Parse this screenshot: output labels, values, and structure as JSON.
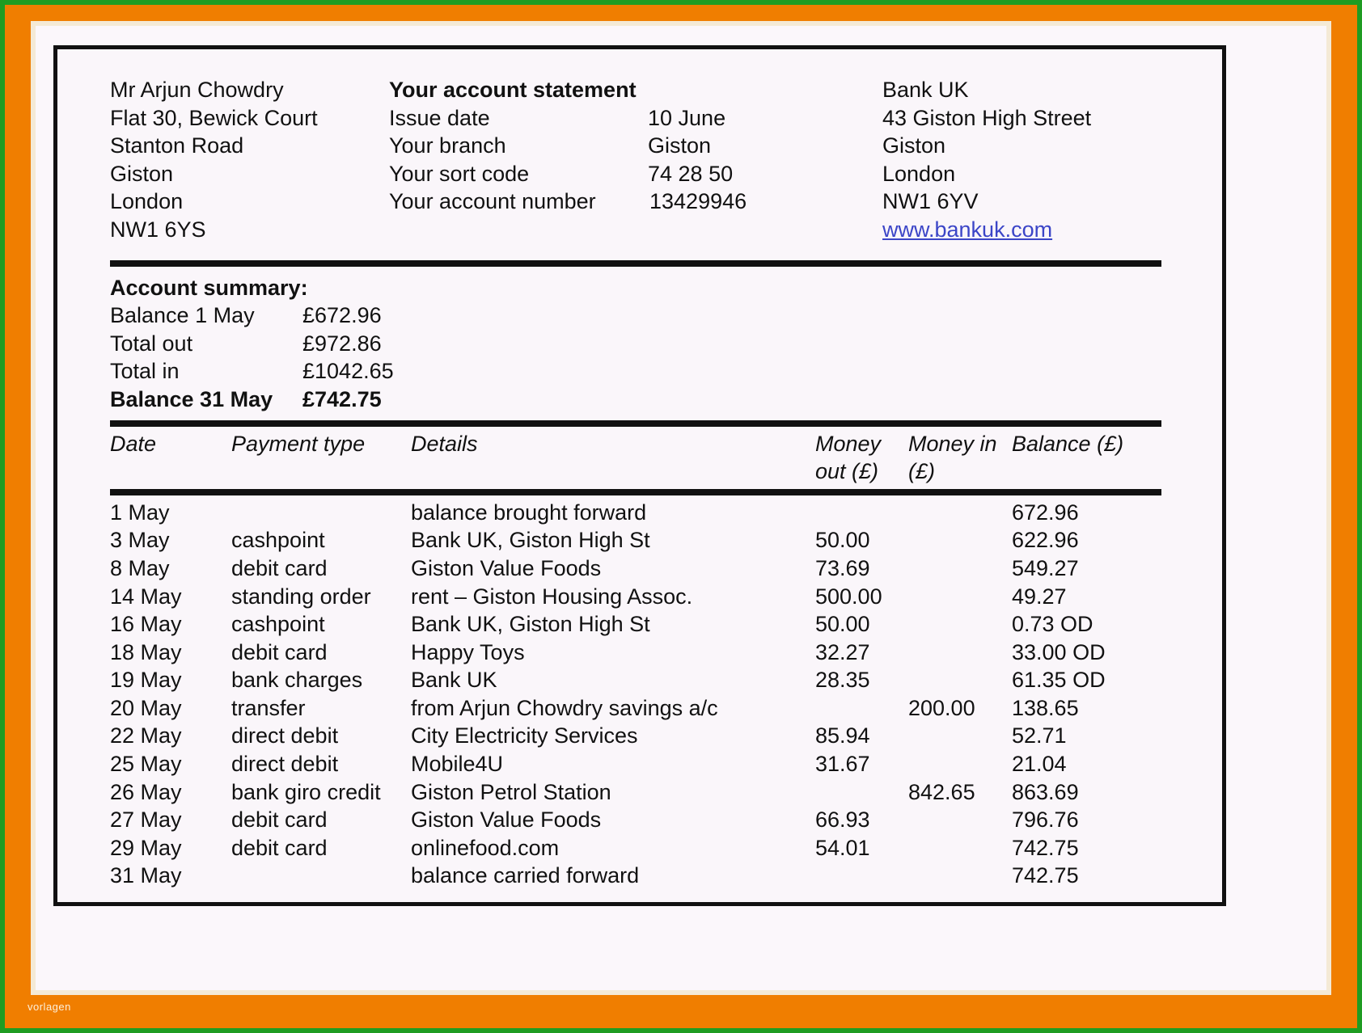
{
  "document": {
    "watermark": "vorlagen",
    "title": "Your account statement"
  },
  "customer": {
    "name": "Mr Arjun Chowdry",
    "address_lines": [
      "Flat 30, Bewick Court",
      "Stanton Road",
      "Giston",
      "London",
      "NW1 6YS"
    ]
  },
  "statement_info": {
    "heading": "Your account statement",
    "fields": [
      {
        "label": "Issue date",
        "value": "10 June"
      },
      {
        "label": "Your branch",
        "value": "Giston"
      },
      {
        "label": "Your sort code",
        "value": "74 28 50"
      },
      {
        "label": "Your account number",
        "value": "13429946"
      }
    ]
  },
  "bank": {
    "name": "Bank UK",
    "address_lines": [
      "43 Giston High Street",
      "Giston",
      "London",
      "NW1 6YV"
    ],
    "website": "www.bankuk.com"
  },
  "summary": {
    "title": "Account summary:",
    "rows": [
      {
        "label": "Balance 1 May",
        "value": "£672.96",
        "bold": false
      },
      {
        "label": "Total out",
        "value": "£972.86",
        "bold": false
      },
      {
        "label": "Total in",
        "value": "£1042.65",
        "bold": false
      },
      {
        "label": "Balance 31 May",
        "value": "£742.75",
        "bold": true
      }
    ]
  },
  "transactions": {
    "columns": {
      "date": "Date",
      "payment_type": "Payment type",
      "details": "Details",
      "money_out_1": "Money",
      "money_out_2": "out (£)",
      "money_in_1": "Money in",
      "money_in_2": "(£)",
      "balance": "Balance (£)"
    },
    "rows": [
      {
        "date": "1 May",
        "type": "",
        "details": "balance brought forward",
        "out": "",
        "in": "",
        "balance": "672.96",
        "bold": true
      },
      {
        "date": "3 May",
        "type": "cashpoint",
        "details": "Bank UK, Giston High St",
        "out": "50.00",
        "in": "",
        "balance": "622.96",
        "bold": false
      },
      {
        "date": "8 May",
        "type": "debit card",
        "details": "Giston Value Foods",
        "out": "73.69",
        "in": "",
        "balance": "549.27",
        "bold": false
      },
      {
        "date": "14 May",
        "type": "standing order",
        "details": "rent – Giston Housing Assoc.",
        "out": "500.00",
        "in": "",
        "balance": "49.27",
        "bold": false
      },
      {
        "date": "16 May",
        "type": "cashpoint",
        "details": "Bank UK, Giston High St",
        "out": "50.00",
        "in": "",
        "balance": "0.73 OD",
        "bold": false
      },
      {
        "date": "18 May",
        "type": "debit card",
        "details": "Happy Toys",
        "out": "32.27",
        "in": "",
        "balance": "33.00 OD",
        "bold": false
      },
      {
        "date": "19 May",
        "type": "bank charges",
        "details": "Bank UK",
        "out": "28.35",
        "in": "",
        "balance": "61.35 OD",
        "bold": false
      },
      {
        "date": "20 May",
        "type": "transfer",
        "details": "from Arjun Chowdry savings a/c",
        "out": "",
        "in": "200.00",
        "balance": "138.65",
        "bold": false
      },
      {
        "date": "22 May",
        "type": "direct debit",
        "details": "City Electricity Services",
        "out": "85.94",
        "in": "",
        "balance": "52.71",
        "bold": false
      },
      {
        "date": "25 May",
        "type": "direct debit",
        "details": "Mobile4U",
        "out": "31.67",
        "in": "",
        "balance": "21.04",
        "bold": false
      },
      {
        "date": "26 May",
        "type": "bank giro credit",
        "details": "Giston Petrol Station",
        "out": "",
        "in": "842.65",
        "balance": "863.69",
        "bold": false
      },
      {
        "date": "27 May",
        "type": "debit card",
        "details": "Giston Value Foods",
        "out": "66.93",
        "in": "",
        "balance": "796.76",
        "bold": false
      },
      {
        "date": "29 May",
        "type": "debit card",
        "details": "onlinefood.com",
        "out": "54.01",
        "in": "",
        "balance": "742.75",
        "bold": false
      },
      {
        "date": "31 May",
        "type": "",
        "details": "balance carried forward",
        "out": "",
        "in": "",
        "balance": "742.75",
        "bold": true
      }
    ]
  },
  "colors": {
    "frame_green": "#1f9c22",
    "frame_orange": "#f07e00",
    "frame_cream": "#f4ead6",
    "paper": "#faf6fa",
    "ink": "#111111",
    "link": "#3b45c7"
  }
}
